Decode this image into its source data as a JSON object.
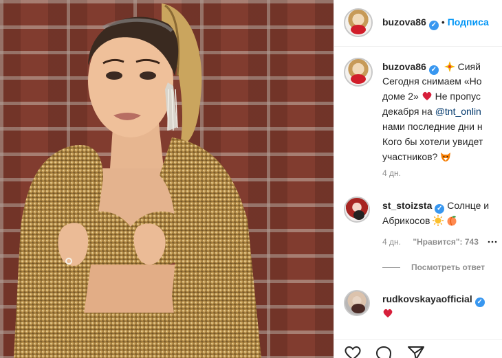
{
  "post_header": {
    "username": "buzova86",
    "separator": "•",
    "follow_label": "Подписа"
  },
  "caption": {
    "username": "buzova86",
    "first_line_after_emoji": "Сияй",
    "line2": "Сегодня снимаем «Но",
    "line3": "доме 2»",
    "line3_after_heart": "Не пропус",
    "line4_start": "декабря на ",
    "line4_link": "@tnt_onlin",
    "line5": "нами последние дни н",
    "line6": "Кого бы хотели увидет",
    "line7": "участников?",
    "time": "4 дн."
  },
  "comments": [
    {
      "username": "st_stoizsta",
      "text_after_name": "Солнце и",
      "line2": "Абрикосов",
      "time": "4 дн.",
      "likes_label": "\"Нравится\": 743",
      "view_replies": "Посмотреть ответ"
    },
    {
      "username": "rudkovskayaofficial"
    }
  ],
  "icons": [
    "verified-badge",
    "sparkle-emoji",
    "heart-emoji",
    "fox-emoji",
    "sun-emoji",
    "peach-emoji",
    "like-icon",
    "comment-icon",
    "share-icon"
  ],
  "colors": {
    "accent": "#0095f6",
    "verified": "#3897f0",
    "muted": "#8e8e8e",
    "heart": "#ed4956"
  }
}
